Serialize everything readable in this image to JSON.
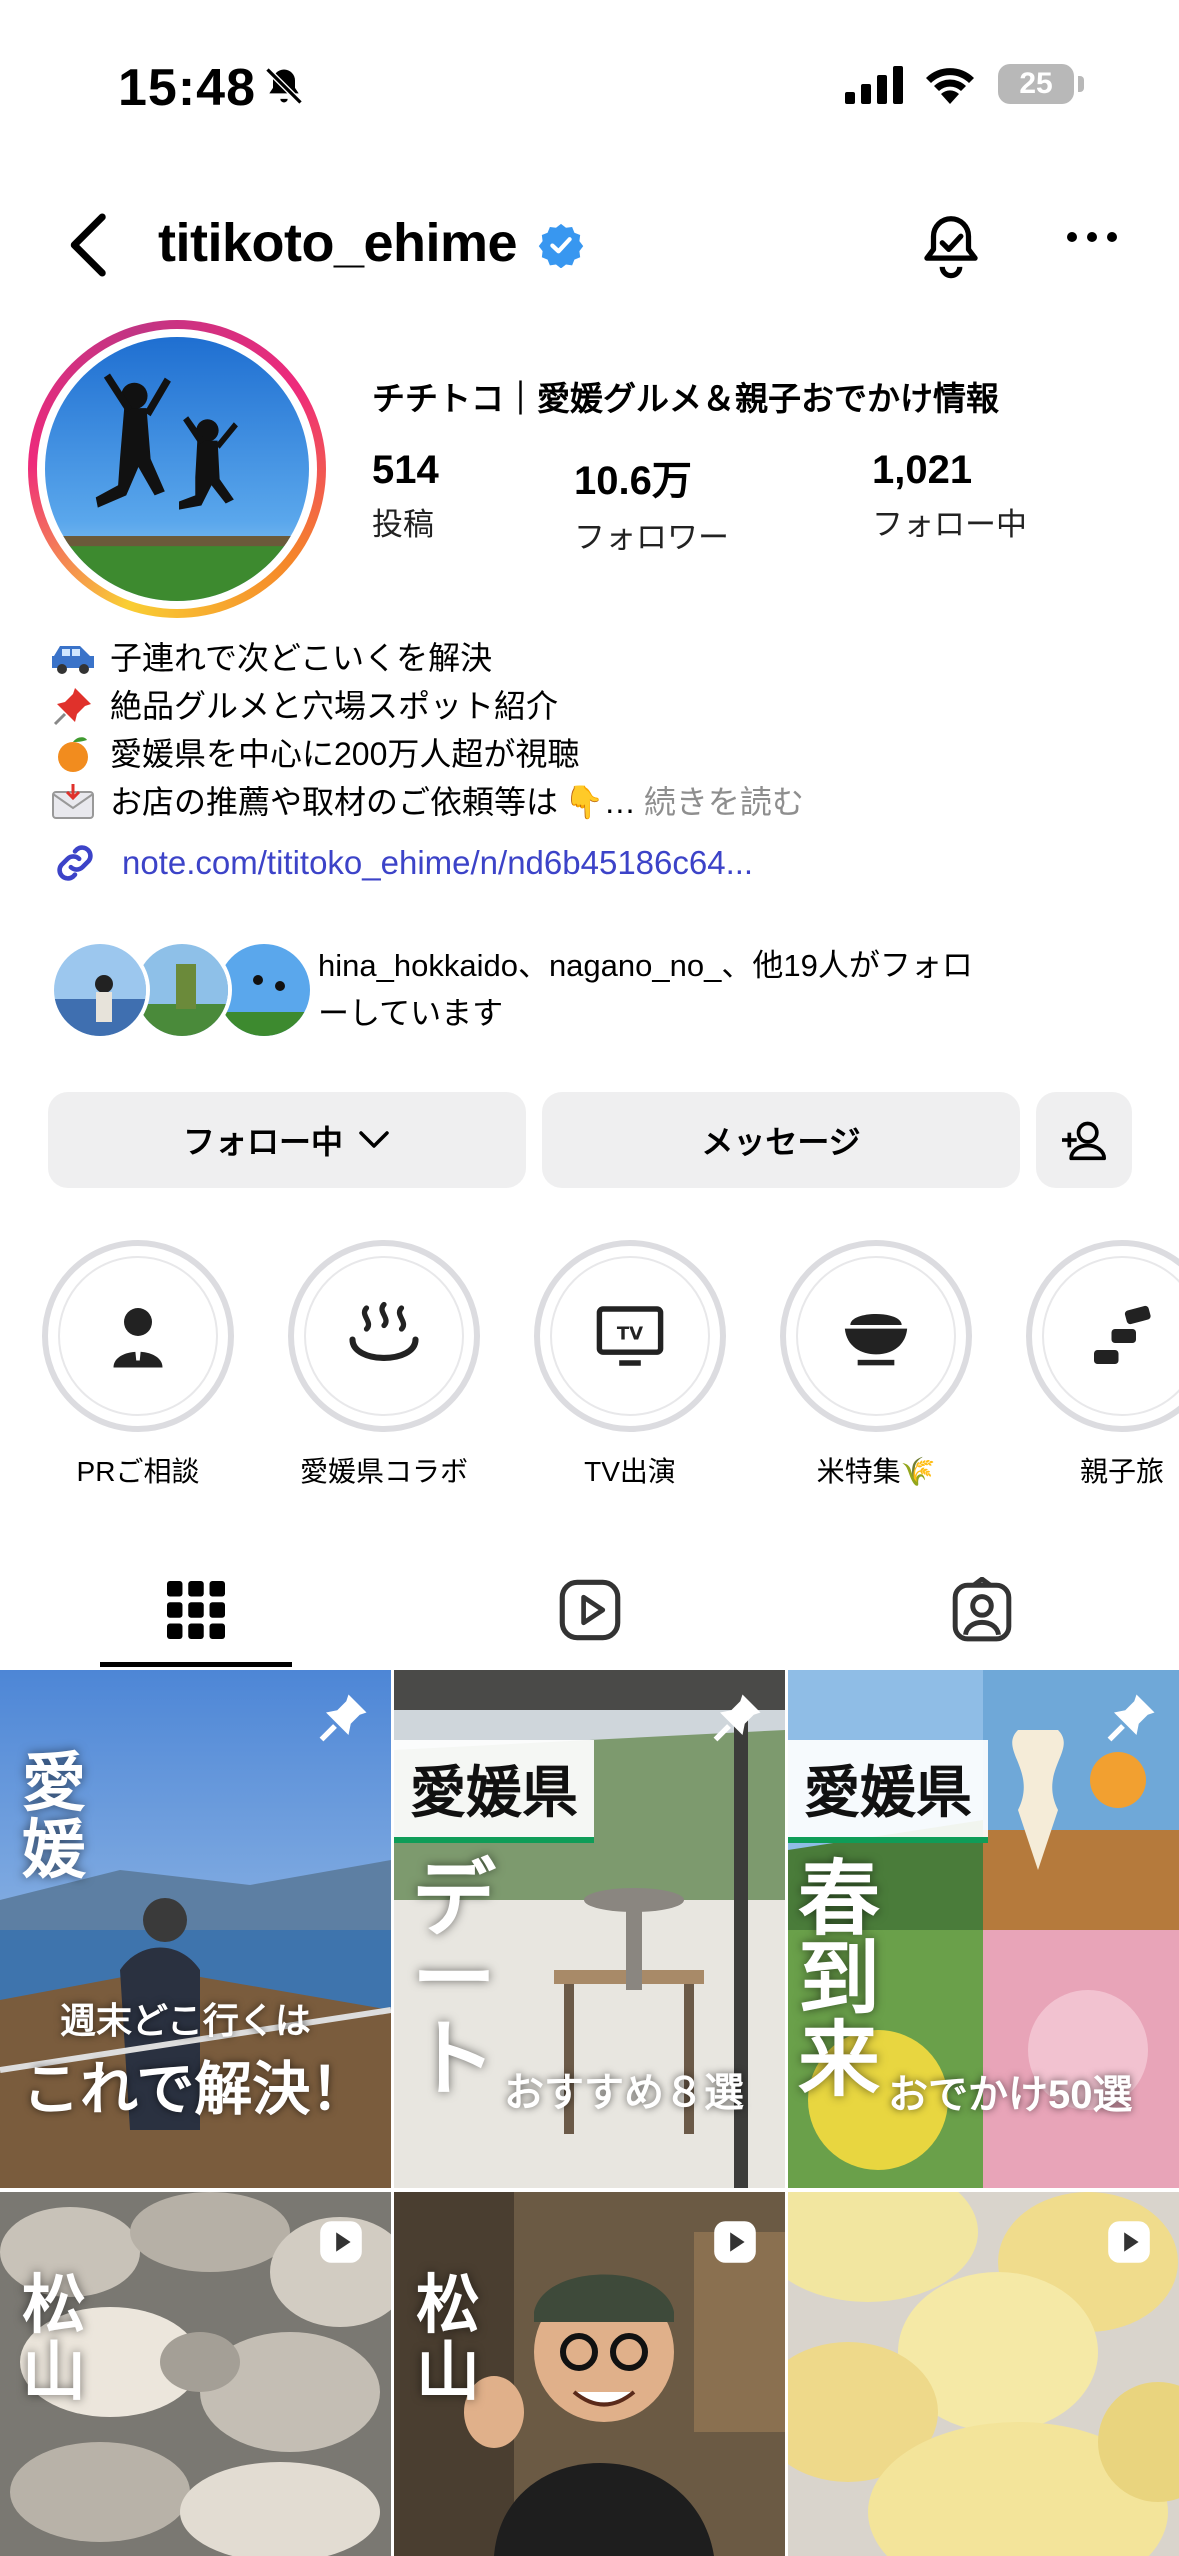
{
  "status_bar": {
    "time": "15:48",
    "battery": "25"
  },
  "header": {
    "username": "titikoto_ehime"
  },
  "profile": {
    "display_name": "チチトコ｜愛媛グルメ＆親子おでかけ情報",
    "stats": [
      {
        "value": "514",
        "label": "投稿"
      },
      {
        "value": "10.6万",
        "label": "フォロワー"
      },
      {
        "value": "1,021",
        "label": "フォロー中"
      }
    ],
    "bio": [
      {
        "icon": "car-emoji",
        "text": "子連れで次どこいくを解決"
      },
      {
        "icon": "pushpin-emoji",
        "text": "絶品グルメと穴場スポット紹介"
      },
      {
        "icon": "orange-emoji",
        "text": "愛媛県を中心に200万人超が視聴"
      },
      {
        "icon": "envelope-emoji",
        "text": "お店の推薦や取材のご依頼等は",
        "suffix": "👇…",
        "more": "続きを読む"
      }
    ],
    "link": "note.com/tititoko_ehime/n/nd6b45186c64...",
    "followed_by": "hina_hokkaido、nagano_no_、他19人がフォロ\nーしています"
  },
  "buttons": {
    "following": "フォロー中",
    "message": "メッセージ"
  },
  "highlights": [
    {
      "label": "PRご相談",
      "icon": "person-icon"
    },
    {
      "label": "愛媛県コラボ",
      "icon": "onsen-icon"
    },
    {
      "label": "TV出演",
      "icon": "tv-icon"
    },
    {
      "label": "米特集🌾",
      "icon": "rice-bowl-icon"
    },
    {
      "label": "親子旅",
      "icon": "stroller-icon"
    }
  ],
  "posts": [
    {
      "big": "愛\n媛",
      "small1": "週末どこ行くは",
      "small2": "これで解決！"
    },
    {
      "tag": "愛媛県",
      "big": "デ\nー\nト",
      "small": "おすすめ８選"
    },
    {
      "tag": "愛媛県",
      "big": "春\n到\n来",
      "small": "おでかけ50選"
    },
    {
      "big": "松\n山"
    },
    {
      "big": "松\n山"
    },
    {}
  ]
}
